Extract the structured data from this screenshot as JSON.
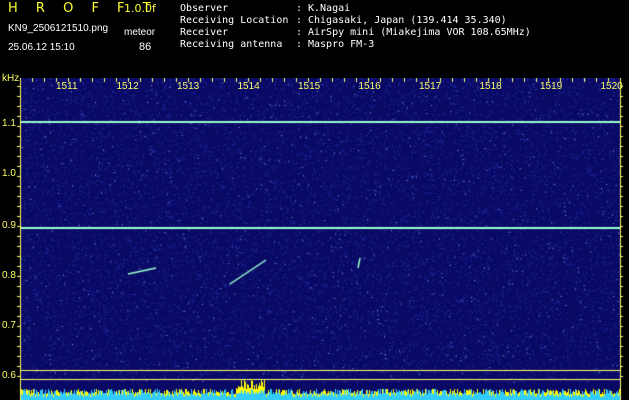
{
  "header": {
    "title": "H R O F F T",
    "version": "1.0.0f",
    "filename": "KN9_2506121510.png",
    "meta_label": "meteor",
    "datetime": "25.06.12 15:10",
    "meteor_count": "86",
    "info": [
      {
        "key": "Observer",
        "value": "K.Nagai"
      },
      {
        "key": "Receiving Location",
        "value": "Chigasaki, Japan (139.414 35.340)"
      },
      {
        "key": "Receiver",
        "value": "AirSpy mini (Miakejima VOR 108.65MHz)"
      },
      {
        "key": "Receiving antenna",
        "value": "Maspro FM-3"
      }
    ]
  },
  "spectrogram": {
    "y_unit": "kHz",
    "y_ticks": [
      "1.1",
      "1.0",
      "0.9",
      "0.8",
      "0.7",
      "0.6"
    ],
    "x_ticks": [
      "1511",
      "1512",
      "1513",
      "1514",
      "1515",
      "1516",
      "1517",
      "1518",
      "1519",
      "1520"
    ],
    "background_color": "#0a0a66",
    "noise_color": "#3344cc",
    "line_color": "#99ffcc",
    "axis_color": "#ffff66",
    "level_color": "#33ccff",
    "level_highlight_color": "#ffff00"
  }
}
